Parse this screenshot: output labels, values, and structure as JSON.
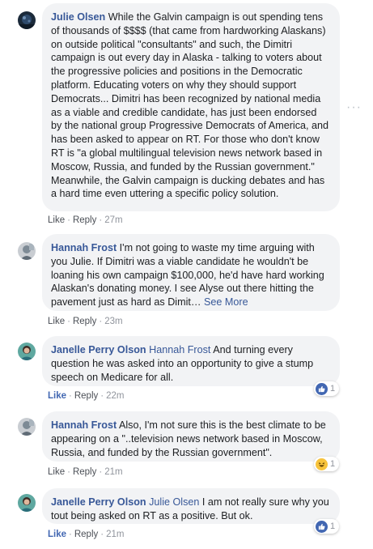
{
  "comments": [
    {
      "author": "Julie Olsen",
      "mention": "",
      "text": " While the Galvin campaign is out spending tens of thousands of $$$$ (that came from hardworking Alaskans) on outside political \"consultants\" and such, the Dimitri campaign is out every day in Alaska - talking to voters about the progressive policies and positions in the Democratic platform. Educating voters on why they should support Democrats... Dimitri has been recognized by national media as a viable and credible candidate, has just been endorsed by the national group Progressive Democrats of America, and has been asked to appear on RT. For those who don't know RT is \"a global multilingual television news network based in Moscow, Russia, and funded by the Russian government.\" Meanwhile, the Galvin campaign is ducking debates and has a hard time even uttering a specific policy solution.",
      "see_more": "",
      "like_label": "Like",
      "reply_label": "Reply",
      "time": "27m",
      "reaction_count": "",
      "avatar_icon": "julie-avatar"
    },
    {
      "author": "Hannah Frost",
      "mention": "",
      "text": " I'm not going to waste my time arguing with you Julie. If Dimitri was a viable candidate he wouldn't be loaning his own campaign $100,000, he'd have hard working Alaskan's donating money. I see Alyse out there hitting the pavement just as hard as Dimit…",
      "see_more": "See More",
      "like_label": "Like",
      "reply_label": "Reply",
      "time": "23m",
      "reaction_count": "",
      "avatar_icon": "hannah-avatar"
    },
    {
      "author": "Janelle Perry Olson",
      "mention": "Hannah Frost",
      "text": " And turning every question he was asked into an opportunity to give a stump speech on Medicare for all.",
      "see_more": "",
      "like_label": "Like",
      "reply_label": "Reply",
      "time": "22m",
      "reaction_count": "1",
      "reaction_icon": "like-icon",
      "avatar_icon": "janelle-avatar"
    },
    {
      "author": "Hannah Frost",
      "mention": "",
      "text": " Also, I'm not sure this is the best climate to be appearing on a \"..television news network based in Moscow, Russia, and funded by the Russian government\".",
      "see_more": "",
      "like_label": "Like",
      "reply_label": "Reply",
      "time": "21m",
      "reaction_count": "1",
      "reaction_icon": "haha-icon",
      "avatar_icon": "hannah-avatar"
    },
    {
      "author": "Janelle Perry Olson",
      "mention": "Julie Olsen",
      "text": " I am not really sure why you tout being asked on RT as a positive. But ok.",
      "see_more": "",
      "like_label": "Like",
      "reply_label": "Reply",
      "time": "21m",
      "reaction_count": "1",
      "reaction_icon": "like-icon",
      "avatar_icon": "janelle-avatar"
    }
  ],
  "separator": "·",
  "more_options_glyph": "···",
  "colors": {
    "author": "#385898",
    "bubble": "#f2f3f5",
    "like_blue": "#4267b2",
    "meta_gray": "#90949c"
  }
}
